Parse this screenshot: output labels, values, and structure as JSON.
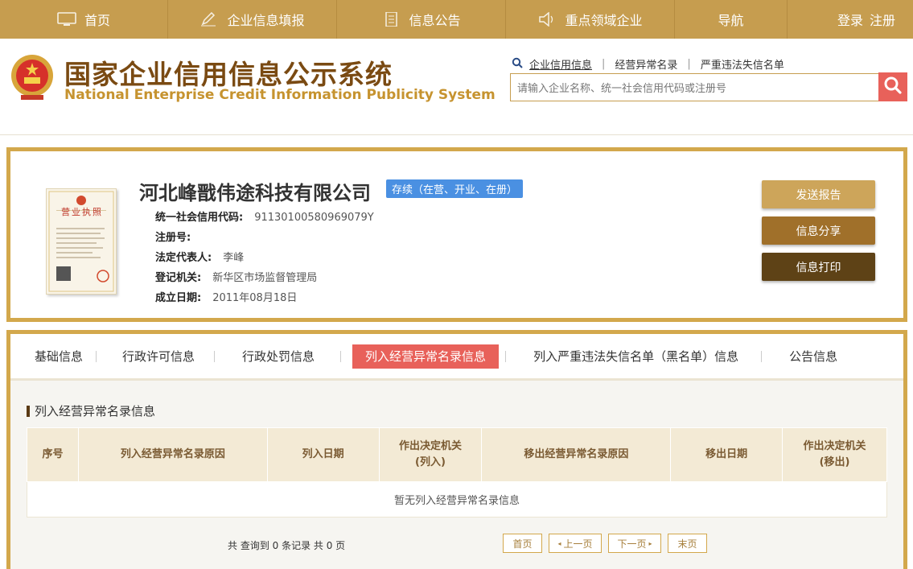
{
  "nav": {
    "items": [
      {
        "label": "首页",
        "icon": "monitor-icon"
      },
      {
        "label": "企业信息填报",
        "icon": "pencil-icon"
      },
      {
        "label": "信息公告",
        "icon": "document-icon"
      },
      {
        "label": "重点领域企业",
        "icon": "speaker-icon"
      },
      {
        "label": "导航",
        "icon": ""
      }
    ],
    "login": "登录",
    "register": "注册"
  },
  "header": {
    "title_cn": "国家企业信用信息公示系统",
    "title_en": "National Enterprise Credit Information Publicity System",
    "quick_links": [
      "企业信用信息",
      "经营异常名录",
      "严重违法失信名单"
    ],
    "search_placeholder": "请输入企业名称、统一社会信用代码或注册号"
  },
  "company": {
    "name": "河北峰戬伟途科技有限公司",
    "status": "存续（在营、开业、在册）",
    "license_title": "营业执照",
    "fields": [
      {
        "label": "统一社会信用代码:",
        "value": "91130100580969079Y"
      },
      {
        "label": "注册号:",
        "value": ""
      },
      {
        "label": "法定代表人:",
        "value": "李峰"
      },
      {
        "label": "登记机关:",
        "value": "新华区市场监督管理局"
      },
      {
        "label": "成立日期:",
        "value": "2011年08月18日"
      }
    ],
    "buttons": [
      {
        "label": "发送报告",
        "color": "#cda55a"
      },
      {
        "label": "信息分享",
        "color": "#a0702a"
      },
      {
        "label": "信息打印",
        "color": "#5e4216"
      }
    ]
  },
  "tabs": [
    {
      "label": "基础信息",
      "active": false
    },
    {
      "label": "行政许可信息",
      "active": false
    },
    {
      "label": "行政处罚信息",
      "active": false
    },
    {
      "label": "列入经营异常名录信息",
      "active": true
    },
    {
      "label": "列入严重违法失信名单（黑名单）信息",
      "active": false
    },
    {
      "label": "公告信息",
      "active": false
    }
  ],
  "section": {
    "title": "列入经营异常名录信息",
    "columns": [
      {
        "l1": "序号",
        "l2": ""
      },
      {
        "l1": "列入经营异常名录原因",
        "l2": ""
      },
      {
        "l1": "列入日期",
        "l2": ""
      },
      {
        "l1": "作出决定机关",
        "l2": "(列入)"
      },
      {
        "l1": "移出经营异常名录原因",
        "l2": ""
      },
      {
        "l1": "移出日期",
        "l2": ""
      },
      {
        "l1": "作出决定机关",
        "l2": "(移出)"
      }
    ],
    "empty_text": "暂无列入经营异常名录信息"
  },
  "pager": {
    "summary": "共 查询到 0 条记录 共 0 页",
    "first": "首页",
    "prev": "上一页",
    "next": "下一页",
    "last": "末页"
  },
  "colors": {
    "gold": "#c69d4f",
    "border": "#d3a84c",
    "accent_red": "#e8615a",
    "status_blue": "#4a90e2"
  }
}
